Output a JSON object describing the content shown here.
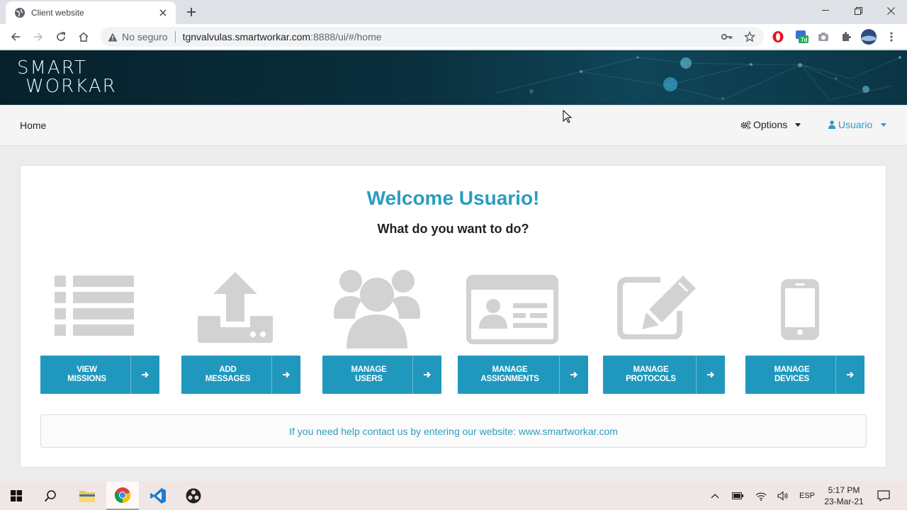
{
  "browser": {
    "tab_title": "Client website",
    "not_secure_label": "No seguro",
    "url_host": "tgnvalvulas.smartworkar.com",
    "url_path": ":8888/ui/#/home",
    "extension_badge": "7d"
  },
  "site": {
    "logo_line1": "SMART",
    "logo_line2": "WORKAR",
    "nav": {
      "home": "Home",
      "options": "Options",
      "user": "Usuario"
    },
    "welcome": "Welcome Usuario!",
    "question": "What do you want to do?",
    "actions": [
      {
        "line1": "VIEW",
        "line2": "MISSIONS",
        "icon": "list-icon"
      },
      {
        "line1": "ADD",
        "line2": "MESSAGES",
        "icon": "upload-icon"
      },
      {
        "line1": "MANAGE",
        "line2": "USERS",
        "icon": "users-icon"
      },
      {
        "line1": "MANAGE",
        "line2": "ASSIGNMENTS",
        "icon": "id-card-icon"
      },
      {
        "line1": "MANAGE",
        "line2": "PROTOCOLS",
        "icon": "edit-icon"
      },
      {
        "line1": "MANAGE",
        "line2": "DEVICES",
        "icon": "mobile-icon"
      }
    ],
    "help_text": "If you need help contact us by entering our website: www.smartworkar.com"
  },
  "taskbar": {
    "lang": "ESP",
    "time": "5:17 PM",
    "date": "23-Mar-21"
  },
  "colors": {
    "accent": "#2098bd",
    "link": "#2c9cbf",
    "icon_gray": "#d0d0d0"
  }
}
